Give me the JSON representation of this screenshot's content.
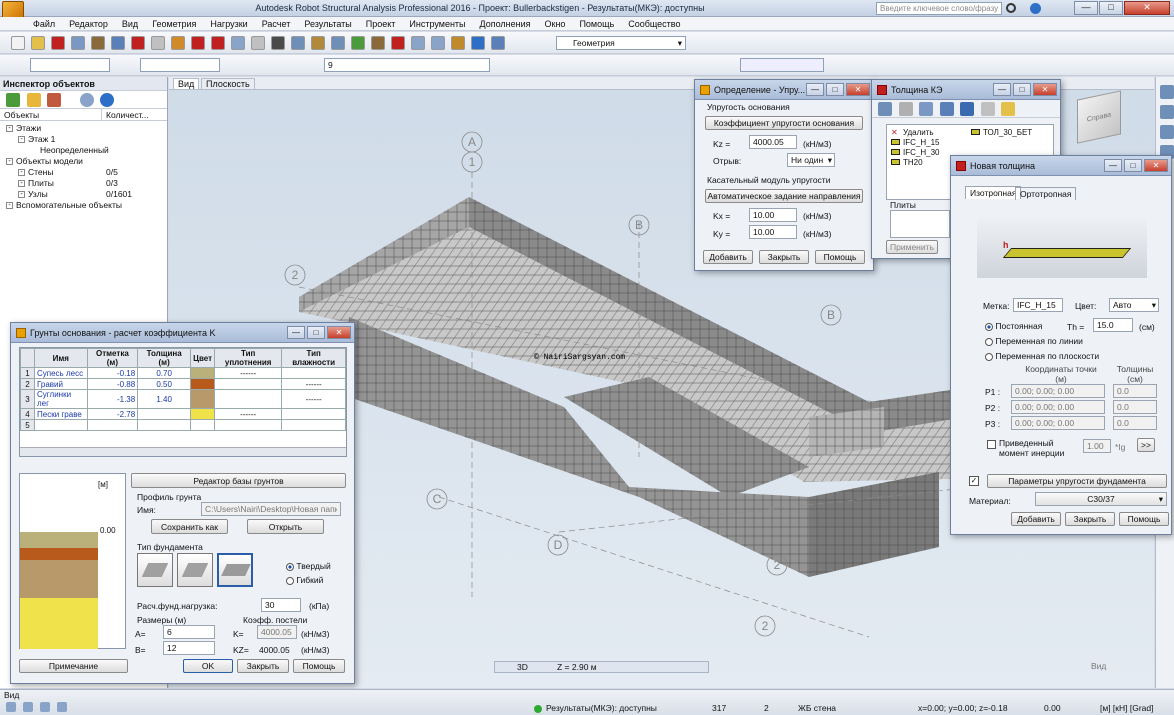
{
  "title": "Autodesk Robot Structural Analysis Professional 2016 - Проект: Bullerbackstigen - Результаты(МКЭ): доступны",
  "search_placeholder": "Введите ключевое слово/фразу",
  "menu": [
    "Файл",
    "Редактор",
    "Вид",
    "Геометрия",
    "Нагрузки",
    "Расчет",
    "Результаты",
    "Проект",
    "Инструменты",
    "Дополнения",
    "Окно",
    "Помощь",
    "Сообщество"
  ],
  "toolbar": {
    "geometry_combo": "Геометрия",
    "num_combo": "9"
  },
  "inspector": {
    "title": "Инспектор объектов",
    "col_objects": "Объекты",
    "col_count": "Количест...",
    "tree": [
      {
        "label": "Этажи",
        "count": "",
        "indent": 0
      },
      {
        "label": "Этаж 1",
        "count": "",
        "indent": 1
      },
      {
        "label": "Неопределенный",
        "count": "",
        "indent": 2
      },
      {
        "label": "Объекты модели",
        "count": "",
        "indent": 0
      },
      {
        "label": "Стены",
        "count": "0/5",
        "indent": 1
      },
      {
        "label": "Плиты",
        "count": "0/3",
        "indent": 1
      },
      {
        "label": "Узлы",
        "count": "0/1601",
        "indent": 1
      },
      {
        "label": "Вспомогательные объекты",
        "count": "",
        "indent": 0
      }
    ]
  },
  "viewport": {
    "tab_view": "Вид",
    "tab_plane": "Плоскость",
    "watermark": "© NairiSargsyan.com",
    "mode": "3D",
    "z": "Z = 2.90 м",
    "cube_label": "Справа",
    "view_label": "Вид",
    "axes": [
      "A",
      "1",
      "B",
      "2",
      "C",
      "D",
      "2",
      "B",
      "2"
    ]
  },
  "soil_dialog": {
    "title": "Грунты основания - расчет коэффициента K",
    "headers": [
      "Имя",
      "Отметка (м)",
      "Толщина (м)",
      "Цвет",
      "Тип уплотнения",
      "Тип влажности"
    ],
    "rows": [
      {
        "n": "1",
        "name": "Супесь лесс",
        "level": "-0.18",
        "thick": "0.70",
        "color": "#b9b07a",
        "dens": "------",
        "wet": ""
      },
      {
        "n": "2",
        "name": "Гравий",
        "level": "-0.88",
        "thick": "0.50",
        "color": "#b85a1c",
        "dens": "",
        "wet": "------"
      },
      {
        "n": "3",
        "name": "Суглинки лег",
        "level": "-1.38",
        "thick": "1.40",
        "color": "#b89a6a",
        "dens": "",
        "wet": "------"
      },
      {
        "n": "4",
        "name": "Пески граве",
        "level": "-2.78",
        "thick": "",
        "color": "#f0e24a",
        "dens": "------",
        "wet": ""
      },
      {
        "n": "5",
        "name": "",
        "level": "",
        "thick": "",
        "color": "",
        "dens": "",
        "wet": ""
      }
    ],
    "profile_unit": "[м]",
    "profile_zero": "0.00",
    "db_editor": "Редактор базы грунтов",
    "profile_label": "Профиль грунта",
    "name_label": "Имя:",
    "path": "C:\\Users\\Nairi\\Desktop\\Новая папка (2",
    "save_as": "Сохранить как",
    "open": "Открыть",
    "foundation_type": "Тип фундамента",
    "rigid": "Твердый",
    "flexible": "Гибкий",
    "load_label": "Расч.фунд.нагрузка:",
    "load_value": "30",
    "load_unit": "(кПа)",
    "sizes_label": "Размеры (м)",
    "coef_label": "Коэфф. постели",
    "a_label": "A=",
    "a_value": "6",
    "b_label": "B=",
    "b_value": "12",
    "k_label": "K=",
    "k_value": "4000.05",
    "k_unit": "(кН/м3)",
    "kz_label": "KZ=",
    "kz_value": "4000.05",
    "kz_unit": "(кН/м3)",
    "note": "Примечание",
    "ok": "OK",
    "close": "Закрыть",
    "help": "Помощь"
  },
  "def_dialog": {
    "title": "Определение - Упру...",
    "elastic": "Упругость основания",
    "coef_btn": "Коэффициент упругости основания",
    "kz_label": "Kz =",
    "kz_value": "4000.05",
    "unit": "(кН/м3)",
    "uplift_label": "Отрыв:",
    "uplift_value": "Ни один",
    "tangent": "Касательный модуль упругости",
    "auto_btn": "Автоматическое задание направления",
    "kx_label": "Kx =",
    "kx_value": "10.00",
    "ky_label": "Ky =",
    "ky_value": "10.00",
    "add": "Добавить",
    "close": "Закрыть",
    "help": "Помощь"
  },
  "thick_panel": {
    "title": "Толщина КЭ",
    "items": [
      "Удалить",
      "IFC_H_15",
      "IFC_H_30",
      "TH20"
    ],
    "item_right": "ТОЛ_30_БЕТ",
    "plates": "Плиты",
    "apply": "Применить"
  },
  "new_thick": {
    "title": "Новая толщина",
    "tab_iso": "Изотропная",
    "tab_ortho": "Ортотропная",
    "h": "h",
    "label_label": "Метка:",
    "label_value": "IFC_H_15",
    "color_label": "Цвет:",
    "color_value": "Авто",
    "constant": "Постоянная",
    "th_label": "Th =",
    "th_value": "15.0",
    "th_unit": "(см)",
    "var_line": "Переменная по линии",
    "var_plane": "Переменная по плоскости",
    "coords_head": "Координаты точки (м)",
    "thick_head": "Толщины (см)",
    "points": [
      {
        "p": "P1 :",
        "c": "0.00; 0.00; 0.00",
        "t": "0.0"
      },
      {
        "p": "P2 :",
        "c": "0.00; 0.00; 0.00",
        "t": "0.0"
      },
      {
        "p": "P3 :",
        "c": "0.00; 0.00; 0.00",
        "t": "0.0"
      }
    ],
    "inertia": "Приведенный момент инерции",
    "inertia_value": "1.00",
    "inertia_unit": "*Ig",
    "elastic_btn": "Параметры упругости фундамента",
    "material_label": "Материал:",
    "material_value": "C30/37",
    "add": "Добавить",
    "close": "Закрыть",
    "help": "Помощь"
  },
  "status": {
    "left": "Вид",
    "results": "Результаты(МКЭ): доступны",
    "n1": "317",
    "n2": "2",
    "type": "ЖБ стена",
    "coords": "x=0.00; y=0.00; z=-0.18",
    "zoom": "0.00",
    "units": "[м] [кН] [Grad]"
  }
}
